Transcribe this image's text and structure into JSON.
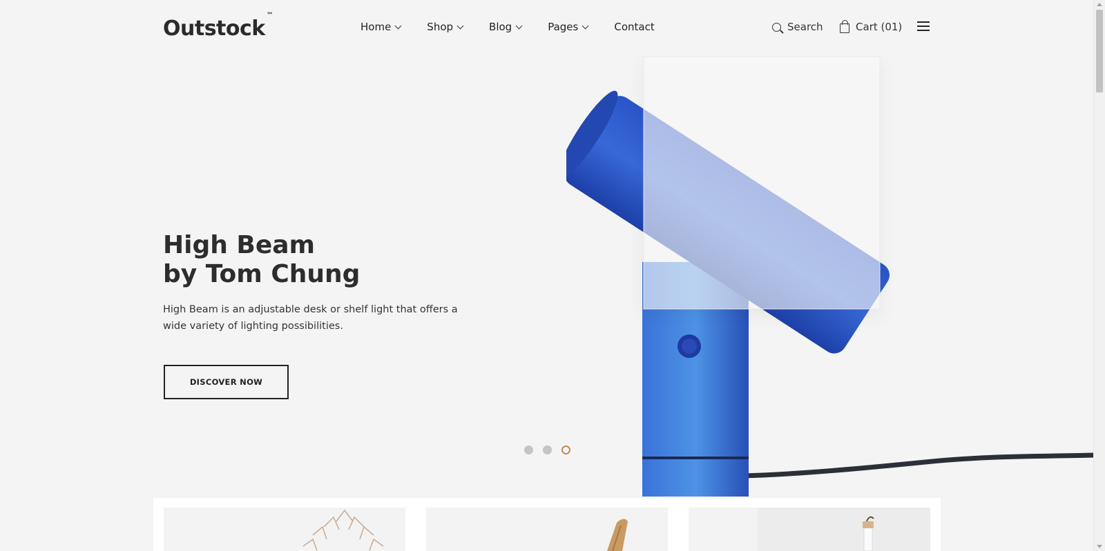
{
  "brand": {
    "name": "Outstock",
    "tm": "™"
  },
  "nav": {
    "items": [
      {
        "label": "Home",
        "has_dropdown": true
      },
      {
        "label": "Shop",
        "has_dropdown": true
      },
      {
        "label": "Blog",
        "has_dropdown": true
      },
      {
        "label": "Pages",
        "has_dropdown": true
      },
      {
        "label": "Contact",
        "has_dropdown": false
      }
    ]
  },
  "header": {
    "search_label": "Search",
    "search_icon": "search-icon",
    "cart_label": "Cart (01)",
    "cart_icon": "shopping-bag-icon",
    "menu_icon": "hamburger-menu-icon"
  },
  "hero": {
    "title_line1": "High Beam",
    "title_line2": "by Tom Chung",
    "description": "High Beam is an adjustable desk or shelf light that offers a wide variety of lighting possibilities.",
    "button_label": "DISCOVER NOW",
    "slider": {
      "total": 3,
      "active_index": 2
    }
  },
  "colors": {
    "background": "#f4f4f4",
    "accent_dot": "#c58a52",
    "lamp_blue": "#2f5fd0"
  },
  "products": {
    "count_visible": 3
  }
}
